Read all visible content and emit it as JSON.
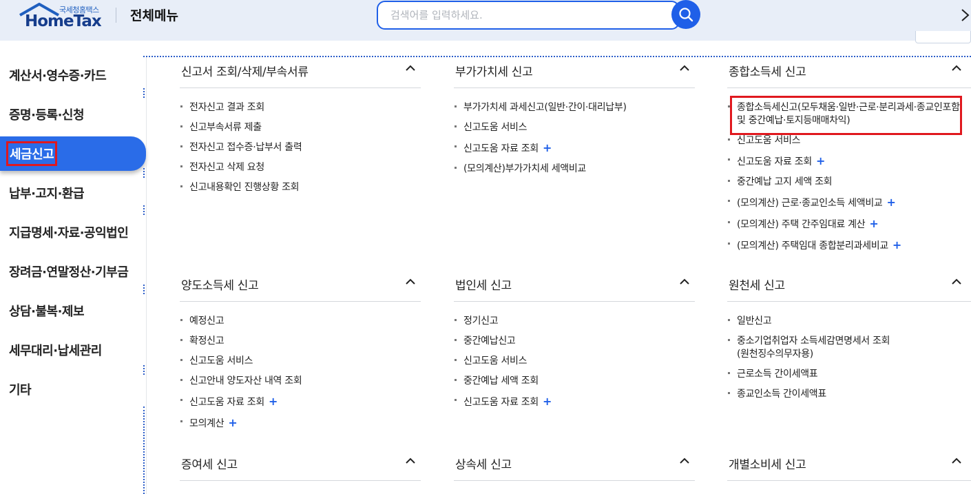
{
  "header": {
    "logo_small": "국세청홈택스",
    "logo_main": "HomeTax",
    "title": "전체메뉴",
    "search_placeholder": "검색어를 입력하세요."
  },
  "sidebar": {
    "items": [
      {
        "label": "계산서·영수증·카드"
      },
      {
        "label": "증명·등록·신청"
      },
      {
        "label": "세금신고",
        "active": true
      },
      {
        "label": "납부·고지·환급"
      },
      {
        "label": "지급명세·자료·공익법인"
      },
      {
        "label": "장려금·연말정산·기부금"
      },
      {
        "label": "상담·불복·제보"
      },
      {
        "label": "세무대리·납세관리"
      },
      {
        "label": "기타"
      }
    ]
  },
  "sections": [
    {
      "title": "신고서 조회/삭제/부속서류",
      "items": [
        {
          "label": "전자신고 결과 조회"
        },
        {
          "label": "신고부속서류 제출"
        },
        {
          "label": "전자신고 접수증·납부서 출력"
        },
        {
          "label": "전자신고 삭제 요청"
        },
        {
          "label": "신고내용확인 진행상황 조회"
        }
      ]
    },
    {
      "title": "부가가치세 신고",
      "items": [
        {
          "label": "부가가치세 과세신고(일반·간이·대리납부)"
        },
        {
          "label": "신고도움 서비스"
        },
        {
          "label": "신고도움 자료 조회",
          "plus": "+"
        },
        {
          "label": "(모의계산)부가가치세 세액비교"
        }
      ]
    },
    {
      "title": "종합소득세 신고",
      "items": [
        {
          "label": "종합소득세신고(모두채움·일반·근로·분리과세·종교인포함",
          "label2": "및 중간예납·토지등매매차익)"
        },
        {
          "label": "신고도움 서비스"
        },
        {
          "label": "신고도움 자료 조회",
          "plus": "+"
        },
        {
          "label": "중간예납 고지 세액 조회"
        },
        {
          "label": "(모의계산) 근로·종교인소득 세액비교",
          "plus": "+"
        },
        {
          "label": "(모의계산) 주택 간주임대료 계산",
          "plus": "+"
        },
        {
          "label": "(모의계산) 주택임대 종합분리과세비교",
          "plus": "+"
        }
      ]
    },
    {
      "title": "양도소득세 신고",
      "items": [
        {
          "label": "예정신고"
        },
        {
          "label": "확정신고"
        },
        {
          "label": "신고도움 서비스"
        },
        {
          "label": "신고안내 양도자산 내역 조회"
        },
        {
          "label": "신고도움 자료 조회",
          "plus": "+"
        },
        {
          "label": "모의계산",
          "plus": "+"
        }
      ]
    },
    {
      "title": "법인세 신고",
      "items": [
        {
          "label": "정기신고"
        },
        {
          "label": "중간예납신고"
        },
        {
          "label": "신고도움 서비스"
        },
        {
          "label": "중간예납 세액 조회"
        },
        {
          "label": "신고도움 자료 조회",
          "plus": "+"
        }
      ]
    },
    {
      "title": "원천세 신고",
      "items": [
        {
          "label": "일반신고"
        },
        {
          "label": "중소기업취업자 소득세감면명세서 조회",
          "label2": "(원천징수의무자용)"
        },
        {
          "label": "근로소득 간이세액표"
        },
        {
          "label": "종교인소득 간이세액표"
        }
      ]
    },
    {
      "title": "증여세 신고",
      "items": []
    },
    {
      "title": "상속세 신고",
      "items": []
    },
    {
      "title": "개별소비세 신고",
      "items": []
    }
  ]
}
